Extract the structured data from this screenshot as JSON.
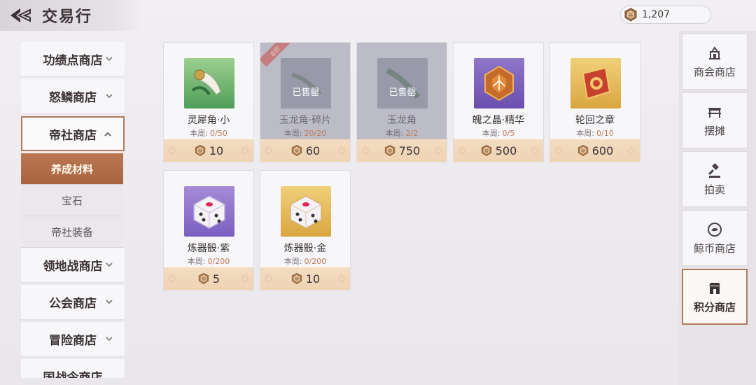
{
  "header": {
    "title": "交易行",
    "currency_value": "1,207",
    "currency_icon": "emperor-coin-icon"
  },
  "left_menu": {
    "items": [
      {
        "label": "功绩点商店"
      },
      {
        "label": "怒鳞商店"
      },
      {
        "label": "帝社商店"
      },
      {
        "label": "领地战商店"
      },
      {
        "label": "公会商店"
      },
      {
        "label": "冒险商店"
      },
      {
        "label": "国战令商店"
      }
    ],
    "sub_items": [
      {
        "label": "养成材料"
      },
      {
        "label": "宝石"
      },
      {
        "label": "帝社装备"
      }
    ]
  },
  "weekly_label": "本周:",
  "sold_label": "已售罄",
  "discount_label": "8折",
  "items": [
    {
      "name": "灵犀角·小",
      "weekly": "0/50",
      "price": "10",
      "icon": "horn-icon"
    },
    {
      "name": "玉龙角·碎片",
      "weekly": "20/20",
      "price": "60",
      "icon": "jade-horn-fragment-icon"
    },
    {
      "name": "玉龙角",
      "weekly": "2/2",
      "price": "750",
      "icon": "jade-horn-icon"
    },
    {
      "name": "魄之晶·精华",
      "weekly": "0/5",
      "price": "500",
      "icon": "crystal-essence-icon"
    },
    {
      "name": "轮回之章",
      "weekly": "0/10",
      "price": "600",
      "icon": "scroll-icon"
    },
    {
      "name": "炼器骰·紫",
      "weekly": "0/200",
      "price": "5",
      "icon": "purple-dice-icon"
    },
    {
      "name": "炼器骰·金",
      "weekly": "0/200",
      "price": "10",
      "icon": "gold-dice-icon"
    }
  ],
  "right_nav": [
    {
      "label": "商会商店",
      "icon": "guild-shop-icon"
    },
    {
      "label": "摆摊",
      "icon": "stall-icon"
    },
    {
      "label": "拍卖",
      "icon": "auction-hammer-icon"
    },
    {
      "label": "鲸币商店",
      "icon": "whale-coin-icon"
    },
    {
      "label": "积分商店",
      "icon": "points-shop-icon"
    }
  ],
  "colors": {
    "accent": "#b07a5a",
    "price_bg": "#efd3b3",
    "active_tab": "#a86440"
  }
}
